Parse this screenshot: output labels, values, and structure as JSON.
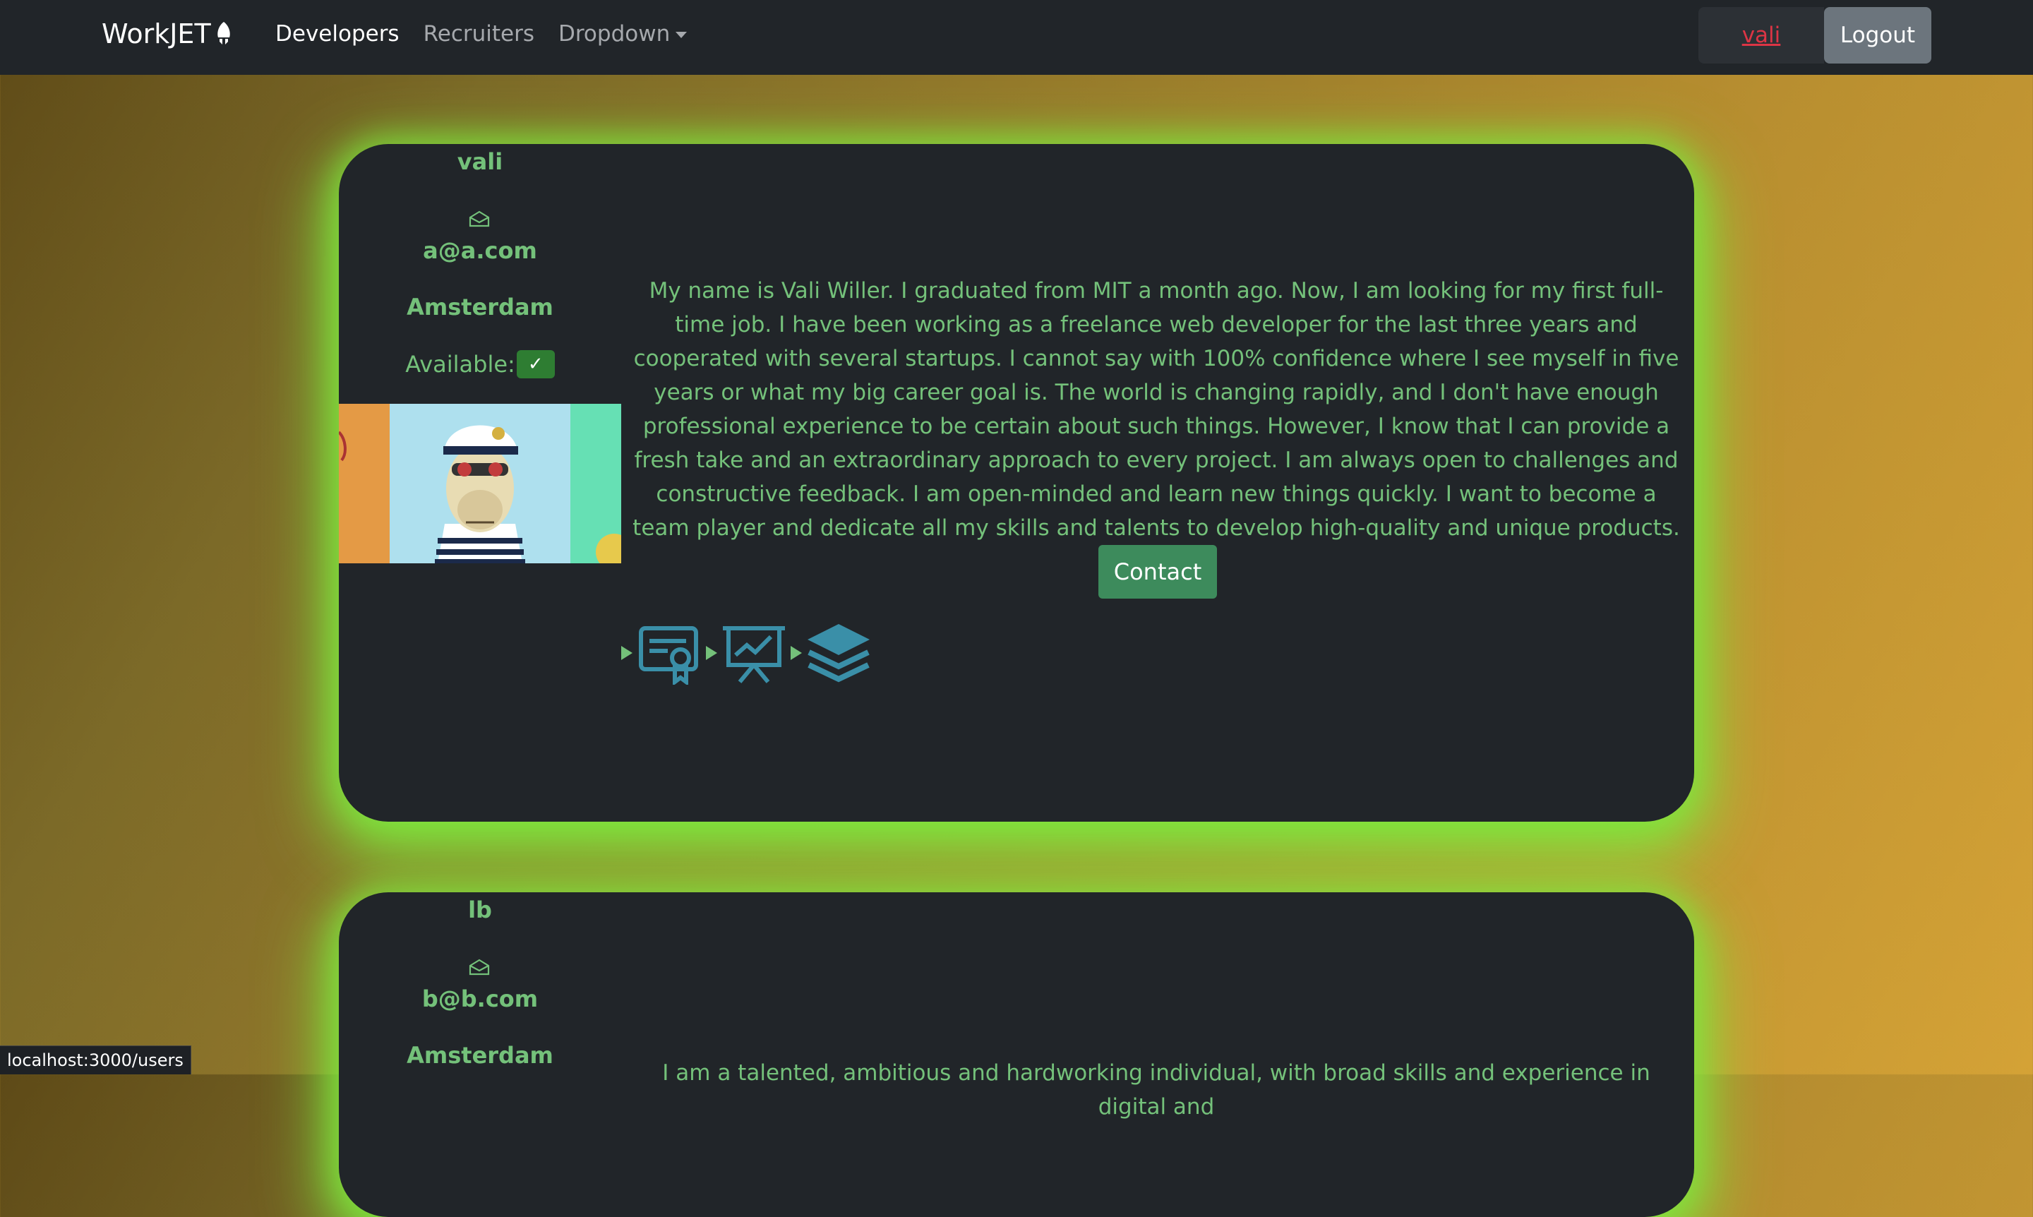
{
  "nav": {
    "brand": "WorkJET",
    "links": [
      "Developers",
      "Recruiters",
      "Dropdown"
    ],
    "user": "vali",
    "logout": "Logout"
  },
  "cards": [
    {
      "name": "vali",
      "email": "a@a.com",
      "city": "Amsterdam",
      "available_label": "Available:",
      "available_check": "✓",
      "bio": "My name is Vali Willer. I graduated from MIT a month ago. Now, I am looking for my first full-time job. I have been working as a freelance web developer for the last three years and cooperated with several startups. I cannot say with 100% confidence where I see myself in five years or what my big career goal is. The world is changing rapidly, and I don't have enough professional experience to be certain about such things. However, I know that I can provide a fresh take and an extraordinary approach to every project. I am always open to challenges and constructive feedback. I am open-minded and learn new things quickly. I want to become a team player and dedicate all my skills and talents to develop high-quality and unique products.",
      "contact": "Contact",
      "skill_icons": [
        "certificate-icon",
        "presentation-chart-icon",
        "layers-icon"
      ]
    },
    {
      "name": "lb",
      "email": "b@b.com",
      "city": "Amsterdam",
      "bio_partial": "I am a talented, ambitious and hardworking individual, with broad skills and experience in digital and"
    }
  ],
  "status_bar": "localhost:3000/users",
  "colors": {
    "navbar": "#212529",
    "card": "#212529",
    "accent_text": "#74c17a",
    "glow": "#7ee83e",
    "user_link": "#dc3545",
    "contact_button": "#3d8b5c",
    "skill_icon": "#3a8fa8"
  }
}
